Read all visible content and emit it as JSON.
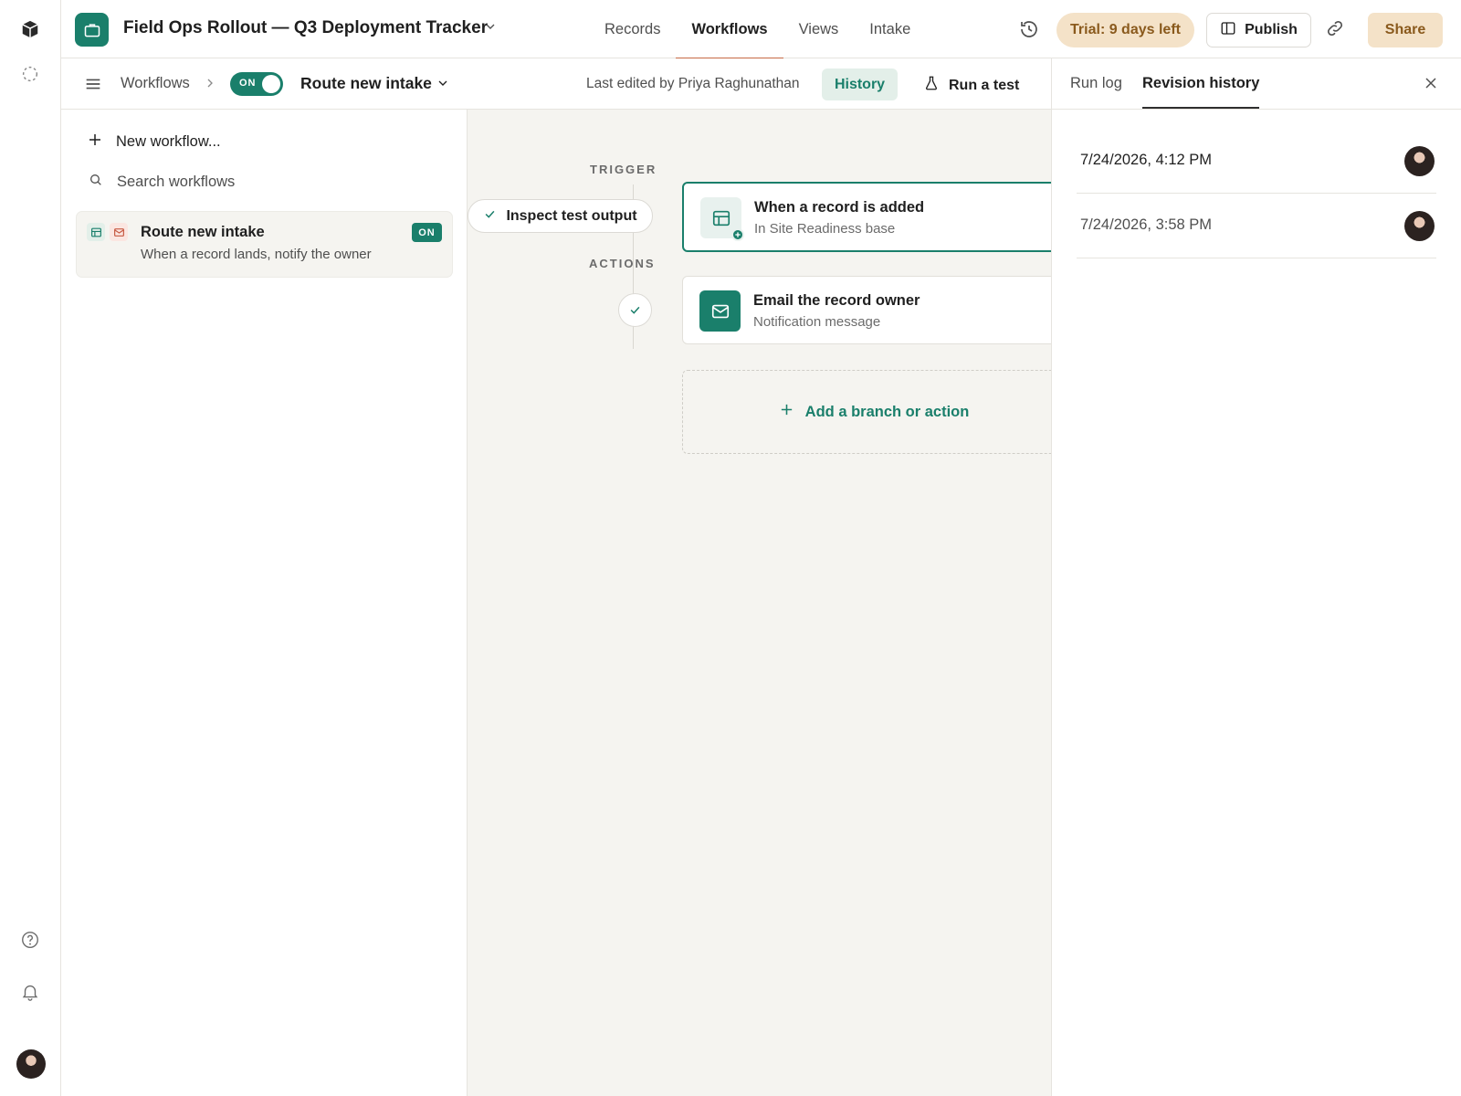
{
  "header": {
    "base_title": "Field Ops Rollout — Q3 Deployment Tracker",
    "tabs": [
      {
        "label": "Records",
        "active": false
      },
      {
        "label": "Workflows",
        "active": true
      },
      {
        "label": "Views",
        "active": false
      },
      {
        "label": "Intake",
        "active": false
      }
    ],
    "trial_label": "Trial: 9 days left",
    "publish_label": "Publish",
    "share_label": "Share"
  },
  "subbar": {
    "breadcrumb": "Workflows",
    "toggle_label": "ON",
    "workflow_name": "Route new intake",
    "last_edited": "Last edited by Priya Raghunathan",
    "history_label": "History",
    "run_test_label": "Run a test"
  },
  "list": {
    "new_workflow_label": "New workflow...",
    "search_placeholder": "Search workflows",
    "items": [
      {
        "title": "Route new intake",
        "description": "When a record lands, notify the owner",
        "status": "ON"
      }
    ]
  },
  "canvas": {
    "trigger_label": "TRIGGER",
    "actions_label": "ACTIONS",
    "inspect_label": "Inspect test output",
    "trigger": {
      "title": "When a record is added",
      "subtitle": "In Site Readiness base"
    },
    "action": {
      "title": "Email the record owner",
      "subtitle": "Notification message"
    },
    "add_label": "Add a branch or action"
  },
  "revision_panel": {
    "tabs": [
      {
        "label": "Run log",
        "active": false
      },
      {
        "label": "Revision history",
        "active": true
      }
    ],
    "entries": [
      {
        "timestamp": "7/24/2026, 4:12 PM"
      },
      {
        "timestamp": "7/24/2026, 3:58 PM"
      }
    ]
  },
  "colors": {
    "accent": "#1a7f6b",
    "trial_bg": "#f4e2c8",
    "tab_underline": "#c66a45",
    "canvas_bg": "#f5f4f0"
  },
  "icons": [
    "cube-logo-icon",
    "loading-icon",
    "help-icon",
    "bell-icon",
    "briefcase-icon",
    "chevron-down-icon",
    "history-icon",
    "publish-icon",
    "link-icon",
    "menu-icon",
    "chevron-right-icon",
    "plus-icon",
    "search-icon",
    "table-icon",
    "mail-icon",
    "check-icon",
    "flask-icon",
    "close-icon"
  ]
}
